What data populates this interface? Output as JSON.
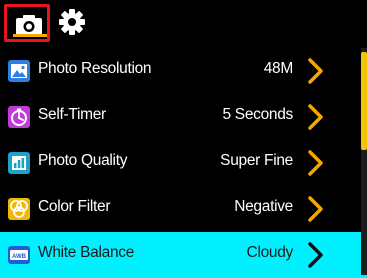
{
  "tabs": {
    "camera": {
      "icon": "camera-icon",
      "selected": true
    },
    "settings": {
      "icon": "gear-icon"
    }
  },
  "menu": {
    "items": [
      {
        "label": "Photo Resolution",
        "value": "48M",
        "icon": "image-icon",
        "selected": false
      },
      {
        "label": "Self-Timer",
        "value": "5 Seconds",
        "icon": "timer-icon",
        "selected": false
      },
      {
        "label": "Photo Quality",
        "value": "Super Fine",
        "icon": "bar-chart-icon",
        "selected": false
      },
      {
        "label": "Color Filter",
        "value": "Negative",
        "icon": "color-circles-icon",
        "selected": false
      },
      {
        "label": "White Balance",
        "value": "Cloudy",
        "icon": "awb-icon",
        "icon_text": "AWB",
        "selected": true
      }
    ]
  },
  "colors": {
    "selected_row": "#00f0ff",
    "camera_tab_border": "#e8141e",
    "chevron": "#f5a700",
    "scroll_thumb": "#f5c400"
  }
}
